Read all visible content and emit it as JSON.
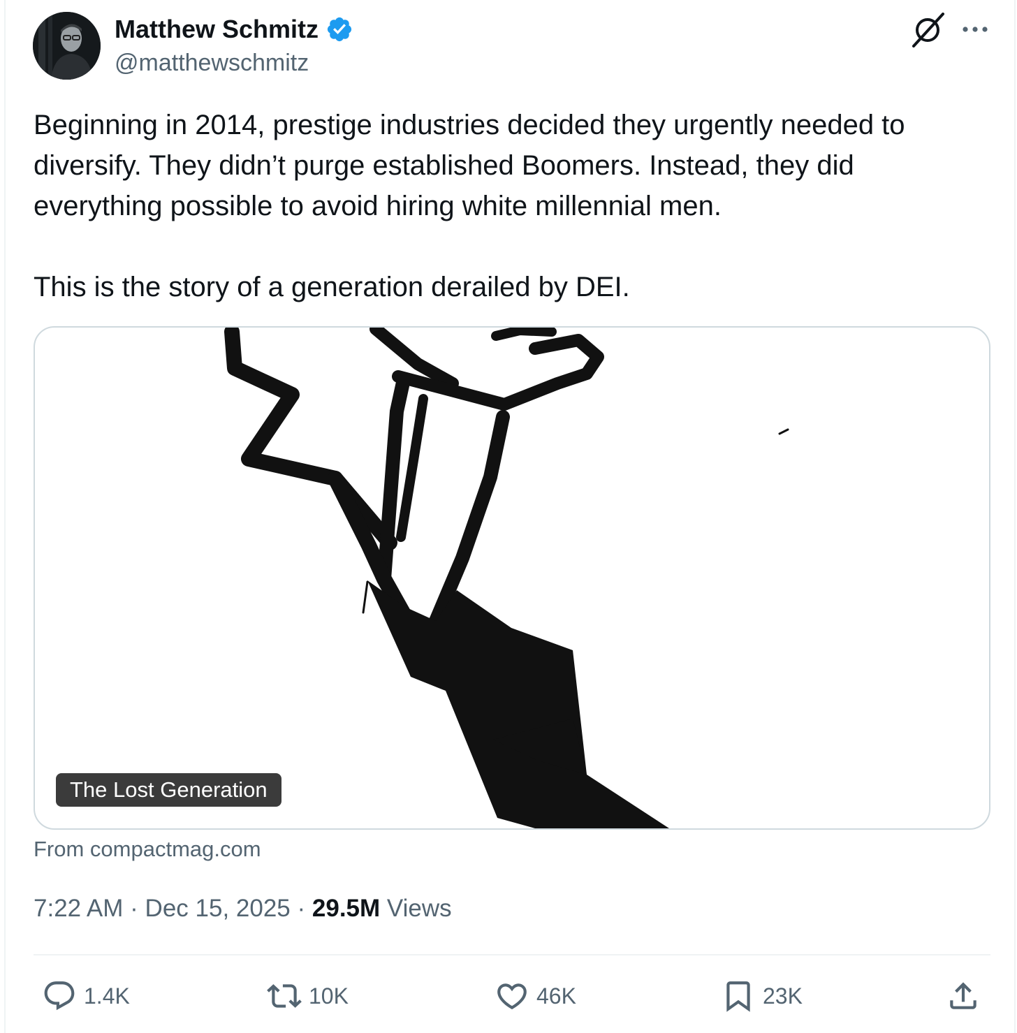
{
  "author": {
    "display_name": "Matthew Schmitz",
    "handle": "@matthewschmitz",
    "verified": true
  },
  "tweet": {
    "paragraphs": [
      "Beginning in 2014, prestige industries decided they urgently needed to",
      "diversify. They didn’t purge established Boomers. Instead, they did",
      "everything possible to avoid hiring white millennial men.",
      "This is the story of a generation derailed by DEI."
    ]
  },
  "card": {
    "label": "The Lost Generation",
    "source": "From compactmag.com"
  },
  "meta": {
    "time": "7:22 AM",
    "sep1": "·",
    "date": "Dec 15, 2025",
    "sep2": "·",
    "views_count": "29.5M",
    "views_label": "Views"
  },
  "actions": {
    "replies": "1.4K",
    "reposts": "10K",
    "likes": "46K",
    "bookmarks": "23K"
  },
  "colors": {
    "text": "#0f1419",
    "secondary": "#536471",
    "verified": "#1d9bf0",
    "border": "#cfd9de"
  },
  "icons": [
    "verified-badge-icon",
    "grok-icon",
    "more-icon",
    "reply-icon",
    "repost-icon",
    "like-icon",
    "bookmark-icon",
    "share-icon"
  ]
}
